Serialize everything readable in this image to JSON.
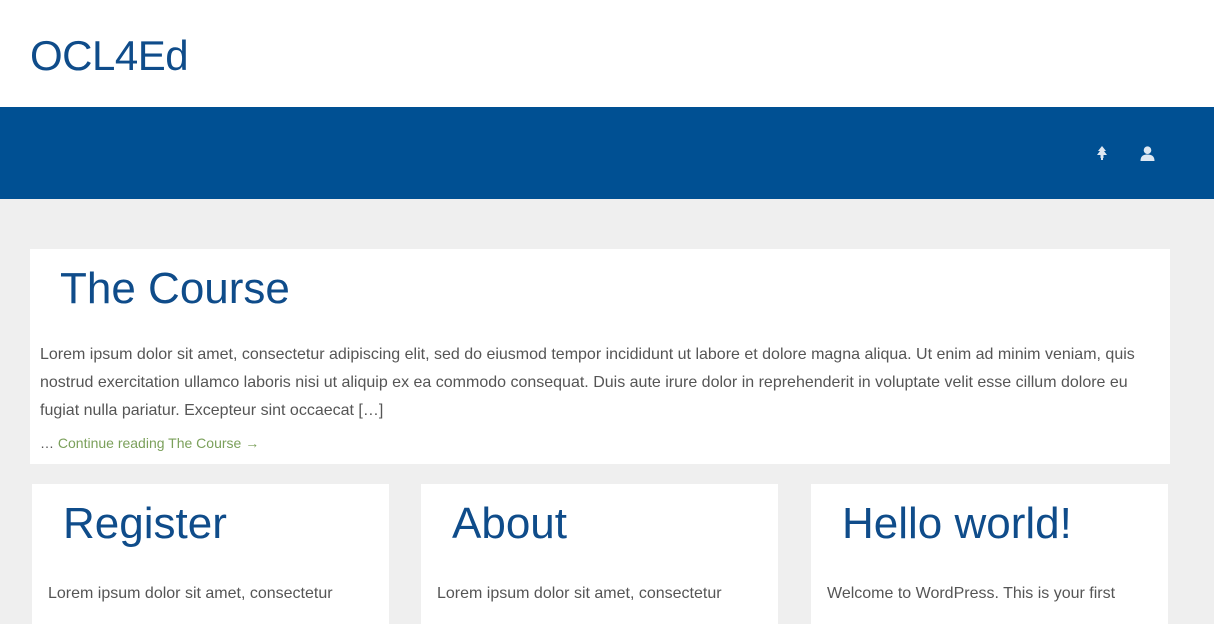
{
  "site": {
    "title": "OCL4Ed"
  },
  "navbar": {
    "icons": [
      "tree-icon",
      "user-icon"
    ],
    "color": "#005093"
  },
  "featured_post": {
    "title": "The Course",
    "excerpt": "Lorem ipsum dolor sit amet, consectetur adipiscing elit, sed do eiusmod tempor incididunt ut labore et dolore magna aliqua. Ut enim ad minim veniam, quis nostrud exercitation ullamco laboris nisi ut aliquip ex ea commodo consequat. Duis aute irure dolor in reprehenderit in voluptate velit esse cillum dolore eu fugiat nulla pariatur. Excepteur sint occaecat […]",
    "ellipsis": "…",
    "continue_link": "Continue reading The Course →"
  },
  "posts": [
    {
      "title": "Register",
      "excerpt": "Lorem ipsum dolor sit amet, consectetur"
    },
    {
      "title": "About",
      "excerpt": "Lorem ipsum dolor sit amet, consectetur"
    },
    {
      "title": "Hello world!",
      "excerpt": "Welcome to WordPress. This is your first"
    }
  ],
  "colors": {
    "title_blue": "#0f4c8a",
    "link_green": "#7ba05b",
    "background": "#efefef"
  }
}
